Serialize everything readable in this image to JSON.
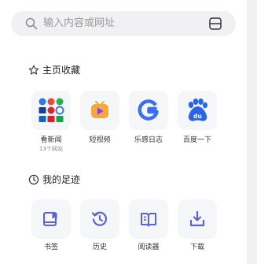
{
  "search": {
    "placeholder": "输入内容或网址",
    "search_icon": "search-icon",
    "scan_icon": "scan-icon"
  },
  "favorites": {
    "title": "主页收藏",
    "title_icon": "star-outline-icon",
    "items": [
      {
        "label": "看新闻",
        "sublabel": "13个网站",
        "icon": "news-grid-icon"
      },
      {
        "label": "短视频",
        "icon": "short-video-icon",
        "color": "#f3a93b"
      },
      {
        "label": "乐感日志",
        "icon": "g-logo-icon",
        "color": "#3b6ef3"
      },
      {
        "label": "百度一下",
        "icon": "baidu-paw-icon",
        "color": "#2b63e6"
      }
    ]
  },
  "footprint": {
    "title": "我的足迹",
    "title_icon": "clock-icon",
    "items": [
      {
        "label": "书签",
        "icon": "bookmark-icon"
      },
      {
        "label": "历史",
        "icon": "history-icon"
      },
      {
        "label": "阅读器",
        "icon": "reader-icon"
      },
      {
        "label": "下载",
        "icon": "download-icon"
      }
    ],
    "accent": "#5a63d8"
  }
}
